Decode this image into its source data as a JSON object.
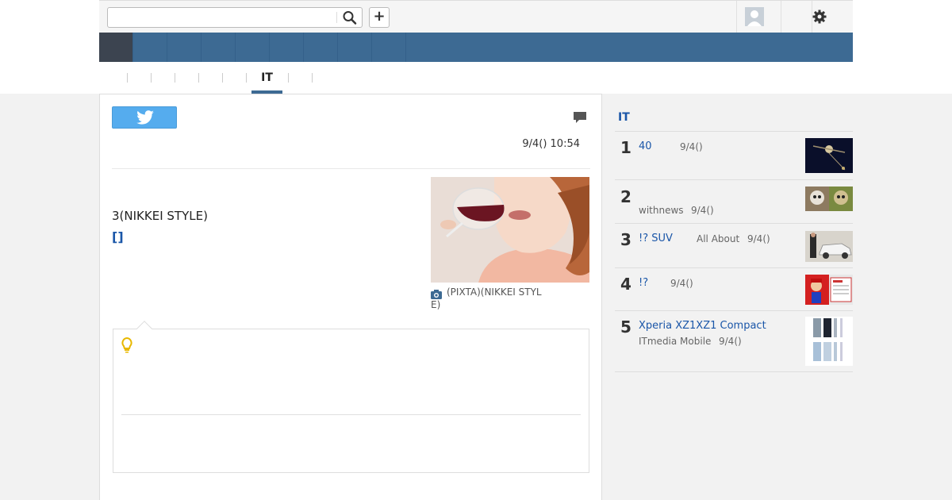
{
  "search": {
    "value": "",
    "placeholder": ""
  },
  "toolbar": {
    "plus_label": "+"
  },
  "subnav": {
    "active_tab": "IT"
  },
  "article": {
    "datetime": "9/4() 10:54",
    "headline": "3(NIKKEI STYLE)",
    "link_brackets": "[]",
    "photo_caption": "(PIXTA)(NIKKEI STYLE)"
  },
  "sidebar": {
    "title": "IT",
    "items": [
      {
        "rank": "1",
        "title": "40",
        "source": "",
        "date": "9/4()"
      },
      {
        "rank": "2",
        "title": "",
        "source": "withnews",
        "date": "9/4()"
      },
      {
        "rank": "3",
        "title": "!? SUV",
        "source": "All About",
        "date": "9/4()"
      },
      {
        "rank": "4",
        "title": "!?",
        "source": "",
        "date": "9/4()"
      },
      {
        "rank": "5",
        "title": "Xperia XZ1XZ1 Compact",
        "source": "ITmedia Mobile",
        "date": "9/4()"
      }
    ]
  },
  "colors": {
    "nav": "#3d6a93",
    "nav_active": "#3c4450",
    "link": "#1a56a8",
    "twitter": "#55acee"
  },
  "icons": [
    "search-icon",
    "plus-icon",
    "avatar-icon",
    "gear-icon",
    "twitter-icon",
    "comment-icon",
    "camera-icon",
    "lightbulb-icon"
  ]
}
